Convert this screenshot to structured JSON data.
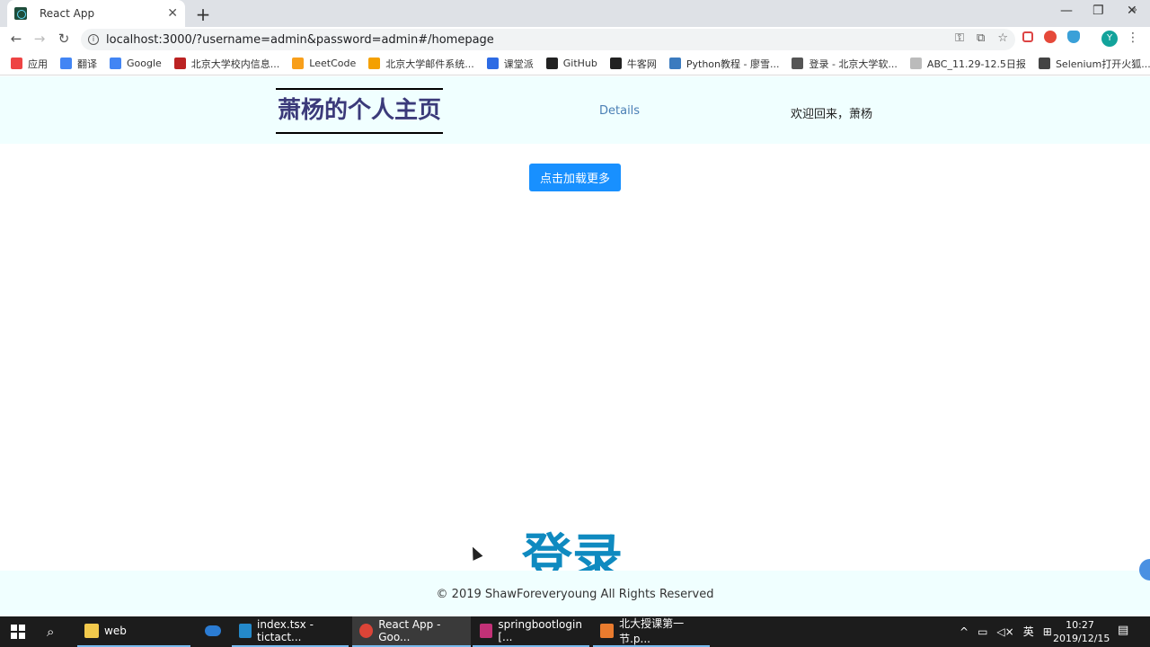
{
  "browser": {
    "tab_title": "React App",
    "url": "localhost:3000/?username=admin&password=admin#/homepage",
    "profile_initial": "Y"
  },
  "bookmarks": [
    {
      "label": "应用",
      "icon": "apps-grid-icon",
      "color": "#e44"
    },
    {
      "label": "翻译",
      "icon": "translate-icon",
      "color": "#4285f4"
    },
    {
      "label": "Google",
      "icon": "google-icon",
      "color": "#4285f4"
    },
    {
      "label": "北京大学校内信息...",
      "icon": "pku-icon",
      "color": "#b22"
    },
    {
      "label": "LeetCode",
      "icon": "leetcode-icon",
      "color": "#f89f1b"
    },
    {
      "label": "北京大学邮件系统...",
      "icon": "mail-at-icon",
      "color": "#f4a000"
    },
    {
      "label": "课堂派",
      "icon": "ketangpai-icon",
      "color": "#2d6be4"
    },
    {
      "label": "GitHub",
      "icon": "github-icon",
      "color": "#222"
    },
    {
      "label": "牛客网",
      "icon": "nowcoder-icon",
      "color": "#222"
    },
    {
      "label": "Python教程 - 廖雪...",
      "icon": "python-icon",
      "color": "#3b7bbf"
    },
    {
      "label": "登录 - 北京大学软...",
      "icon": "globe-icon",
      "color": "#555"
    },
    {
      "label": "ABC_11.29-12.5日报",
      "icon": "doc-icon",
      "color": "#bbb"
    },
    {
      "label": "Selenium打开火狐...",
      "icon": "selenium-icon",
      "color": "#444"
    }
  ],
  "page": {
    "site_title": "萧杨的个人主页",
    "details_link": "Details",
    "welcome": "欢迎回来，萧杨",
    "load_more_button": "点击加载更多",
    "login_heading": "登录",
    "copyright": "© 2019 ShawForeveryoung All Rights Reserved"
  },
  "taskbar": {
    "items": [
      {
        "label": "web",
        "icon": "folder-icon",
        "color": "#f2c94c"
      },
      {
        "label": "index.tsx - tictact...",
        "icon": "vscode-icon",
        "color": "#2489ca"
      },
      {
        "label": "React App - Goo...",
        "icon": "chrome-icon",
        "color": "#db4437"
      },
      {
        "label": "springbootlogin [...",
        "icon": "intellij-icon",
        "color": "#c23177"
      },
      {
        "label": "北大授课第一节.p...",
        "icon": "powerpoint-icon",
        "color": "#e97b2e"
      }
    ],
    "ime": "英",
    "time": "10:27",
    "date": "2019/12/15"
  }
}
